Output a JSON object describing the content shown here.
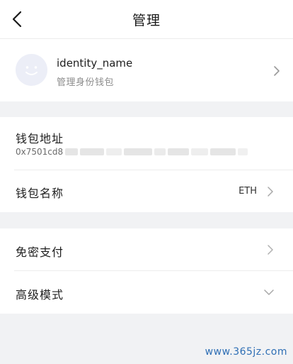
{
  "header": {
    "title": "管理"
  },
  "profile": {
    "name": "identity_name",
    "subtitle": "管理身份钱包"
  },
  "wallet": {
    "address_label": "钱包地址",
    "address_visible": "0x7501cd8",
    "name_label": "钱包名称",
    "name_value": "ETH"
  },
  "settings": {
    "password_free_label": "免密支付",
    "advanced_mode_label": "高级模式"
  },
  "watermark": "www.365jz.com",
  "colors": {
    "background": "#f1f2f4",
    "card": "#ffffff",
    "avatar_bg": "#eceef7",
    "watermark": "#2f6fb5"
  },
  "icons": {
    "back": "chevron-left-icon",
    "avatar": "smiley-face-icon",
    "row_arrow": "chevron-right-icon",
    "expand": "chevron-down-icon"
  }
}
